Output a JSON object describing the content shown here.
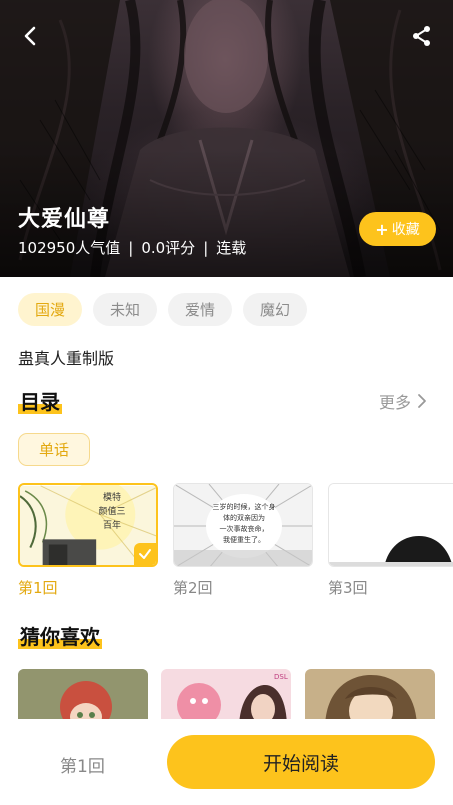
{
  "hero": {
    "title": "大爱仙尊",
    "popularity": "102950人气值",
    "rating": "0.0评分",
    "status": "连载",
    "separator": "|",
    "favorite_label": "收藏",
    "back_icon": "chevron-left-icon",
    "share_icon": "share-icon"
  },
  "tags": [
    "国漫",
    "未知",
    "爱情",
    "魔幻"
  ],
  "author": "蛊真人重制版",
  "catalog": {
    "title": "目录",
    "more_label": "更多",
    "filter_label": "单话",
    "chapters": [
      {
        "label": "第1回",
        "selected": true
      },
      {
        "label": "第2回",
        "selected": false
      },
      {
        "label": "第3回",
        "selected": false
      }
    ],
    "thumb_text": {
      "ch1": [
        "模特",
        "颜值三",
        "百年"
      ],
      "ch2": [
        "三岁的时候，这个身",
        "体的双亲因为",
        "一次事故丧命，",
        "我便重生了。"
      ]
    }
  },
  "guess": {
    "title": "猜你喜欢",
    "rec_badge": "DSL"
  },
  "bottom": {
    "current_chapter": "第1回",
    "start_label": "开始阅读"
  },
  "colors": {
    "accent": "#fdc31c",
    "accent_text": "#e3a911",
    "tag_bg": "#f2f2f2",
    "tag_active_bg": "#fff4cf"
  }
}
